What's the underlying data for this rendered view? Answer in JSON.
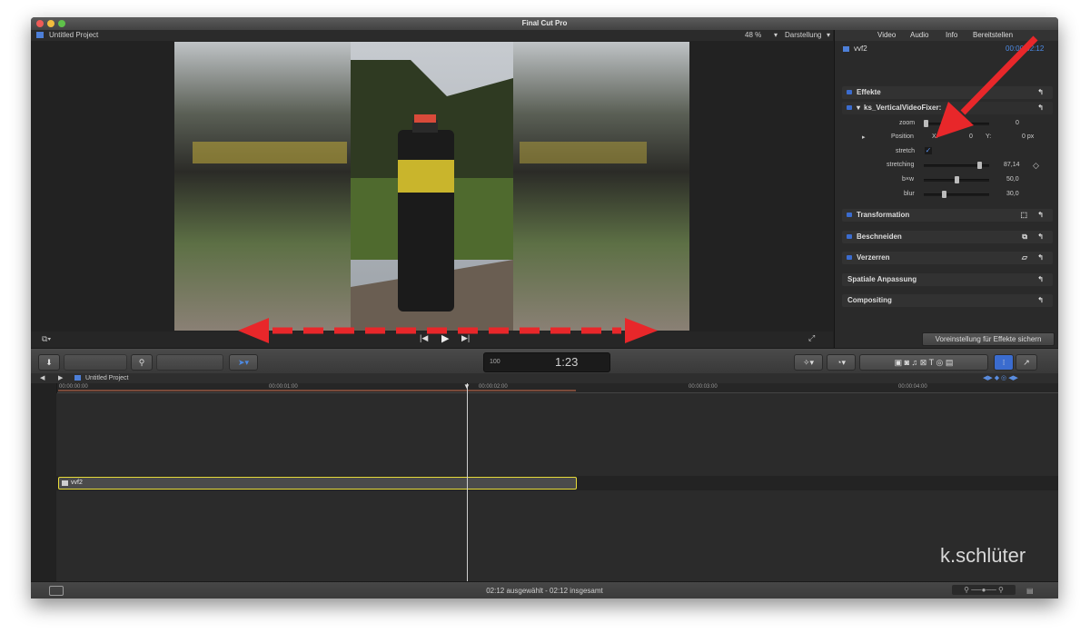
{
  "window": {
    "title": "Final Cut Pro"
  },
  "project": {
    "name": "Untitled Project",
    "zoom": "48 %",
    "view_menu": "Darstellung"
  },
  "inspector": {
    "tabs": [
      "Video",
      "Audio",
      "Info",
      "Bereitstellen"
    ],
    "clip_name": "vvf2",
    "clip_time": "00:00:02:12",
    "effects_header": "Effekte",
    "effect_name": "ks_VerticalVideoFixer:",
    "params": {
      "zoom": {
        "label": "zoom",
        "value": "0"
      },
      "position": {
        "label": "Position",
        "x_label": "X:",
        "x_value": "0",
        "y_label": "Y:",
        "y_value": "0 px"
      },
      "stretch": {
        "label": "stretch"
      },
      "stretching": {
        "label": "stretching",
        "value": "87,14"
      },
      "bxw": {
        "label": "b×w",
        "value": "50,0"
      },
      "blur": {
        "label": "blur",
        "value": "30,0"
      }
    },
    "sections": [
      "Transformation",
      "Beschneiden",
      "Verzerren",
      "Spatiale Anpassung",
      "Compositing"
    ],
    "save_preset": "Voreinstellung für Effekte sichern"
  },
  "toolbar": {
    "timecode": "1:23",
    "timecode_prefix": "100"
  },
  "timeline": {
    "project": "Untitled Project",
    "ruler": [
      "00:00:00:00",
      "00:00:01:00",
      "00:00:02:00",
      "00:00:03:00",
      "00:00:04:00"
    ],
    "clip_label": "vvf2"
  },
  "status": {
    "selection": "02:12 ausgewählt - 02:12 insgesamt"
  },
  "watermark": "k.schlüter",
  "colors": {
    "arrow": "#e8272a",
    "clip_border": "#e9dd3a",
    "accent_blue": "#3b6ccf"
  }
}
